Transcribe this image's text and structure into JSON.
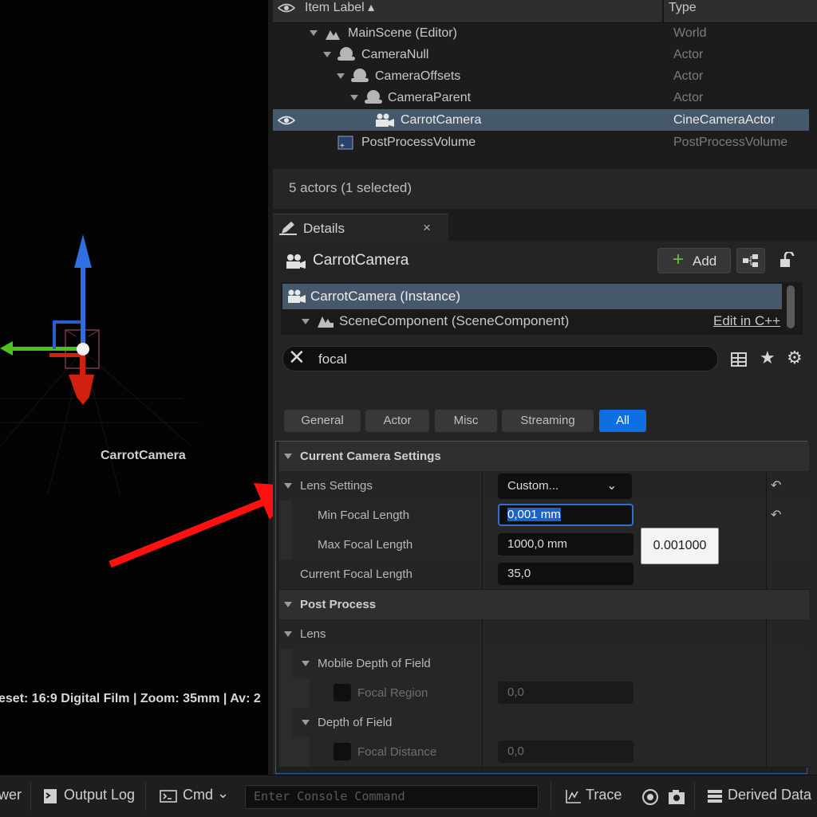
{
  "viewport": {
    "actor_label": "CarrotCamera",
    "overlay_text": "eset: 16:9 Digital Film | Zoom: 35mm | Av: 2"
  },
  "outliner": {
    "header": {
      "label": "Item Label ▴",
      "type": "Type"
    },
    "rows": [
      {
        "name": "MainScene (Editor)",
        "type": "World"
      },
      {
        "name": "CameraNull",
        "type": "Actor"
      },
      {
        "name": "CameraOffsets",
        "type": "Actor"
      },
      {
        "name": "CameraParent",
        "type": "Actor"
      },
      {
        "name": "CarrotCamera",
        "type": "CineCameraActor"
      },
      {
        "name": "PostProcessVolume",
        "type": "PostProcessVolume"
      }
    ],
    "status": "5 actors (1 selected)"
  },
  "details": {
    "tab_label": "Details",
    "tab_close": "×",
    "object_name": "CarrotCamera",
    "add_label": "Add",
    "components": {
      "instance": "CarrotCamera (Instance)",
      "scene_component": "SceneComponent (SceneComponent)",
      "edit_link": "Edit in C++"
    },
    "search": {
      "value": "focal"
    },
    "filters": [
      "General",
      "Actor",
      "Misc",
      "Streaming",
      "All"
    ],
    "active_filter": "All",
    "properties": {
      "current_camera_settings": "Current Camera Settings",
      "lens_settings": {
        "label": "Lens Settings",
        "value": "Custom..."
      },
      "min_focal_length": {
        "label": "Min Focal Length",
        "value": "0,001 mm"
      },
      "max_focal_length": {
        "label": "Max Focal Length",
        "value": "1000,0 mm"
      },
      "tooltip": "0.001000",
      "current_focal_length": {
        "label": "Current Focal Length",
        "value": "35,0"
      },
      "post_process": "Post Process",
      "lens": "Lens",
      "mobile_dof": "Mobile Depth of Field",
      "focal_region": {
        "label": "Focal Region",
        "value": "0,0"
      },
      "dof": "Depth of Field",
      "focal_distance": {
        "label": "Focal Distance",
        "value": "0,0"
      }
    }
  },
  "bottombar": {
    "partial": "wer",
    "output_log": "Output Log",
    "cmd": "Cmd",
    "console_placeholder": "Enter Console Command",
    "trace": "Trace",
    "derived_data": "Derived Data"
  },
  "colors": {
    "accent": "#0d6fe2",
    "selection": "#46586b",
    "arrow": "#ff1010"
  }
}
